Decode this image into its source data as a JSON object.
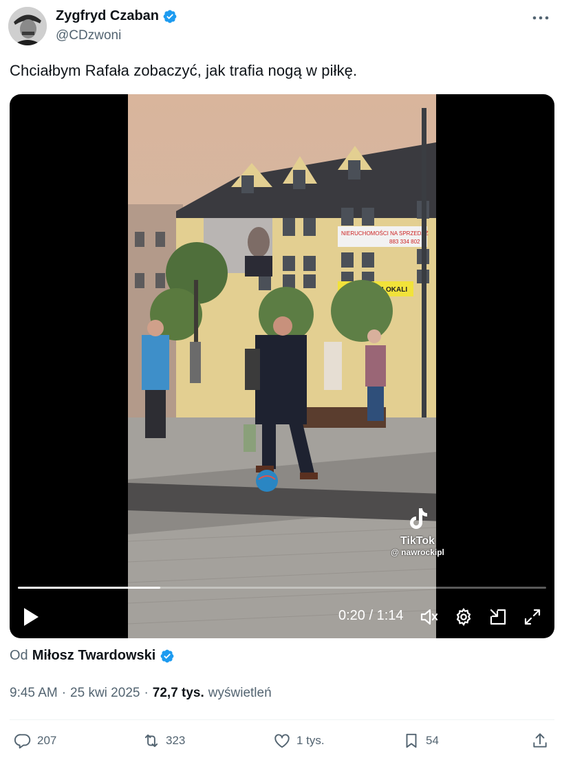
{
  "author": {
    "name": "Zygfryd Czaban",
    "handle": "@CDzwoni"
  },
  "more_icon": "ellipsis-icon",
  "tweet": {
    "text": "Chciałbym Rafała zobaczyć, jak trafia nogą w piłkę."
  },
  "video": {
    "watermark_brand": "TikTok",
    "watermark_user": "@ nawrockipl",
    "time": "0:20 / 1:14",
    "progress": 0.27,
    "banner_text": "NIERUCHOMOŚCI NA SPRZEDAŻ",
    "banner_phone": "883 334 802",
    "lokale_text": "WYNAJEM LOKALI"
  },
  "attribution": {
    "prefix": "Od",
    "name": "Miłosz Twardowski"
  },
  "meta": {
    "time": "9:45 AM",
    "sep1": "·",
    "date": "25 kwi 2025",
    "sep2": "·",
    "views": "72,7 tys.",
    "views_label": "wyświetleń"
  },
  "actions": {
    "replies": "207",
    "reposts": "323",
    "likes": "1 tys.",
    "bookmarks": "54"
  },
  "colors": {
    "verified": "#1d9bf0",
    "text_secondary": "#536471"
  }
}
